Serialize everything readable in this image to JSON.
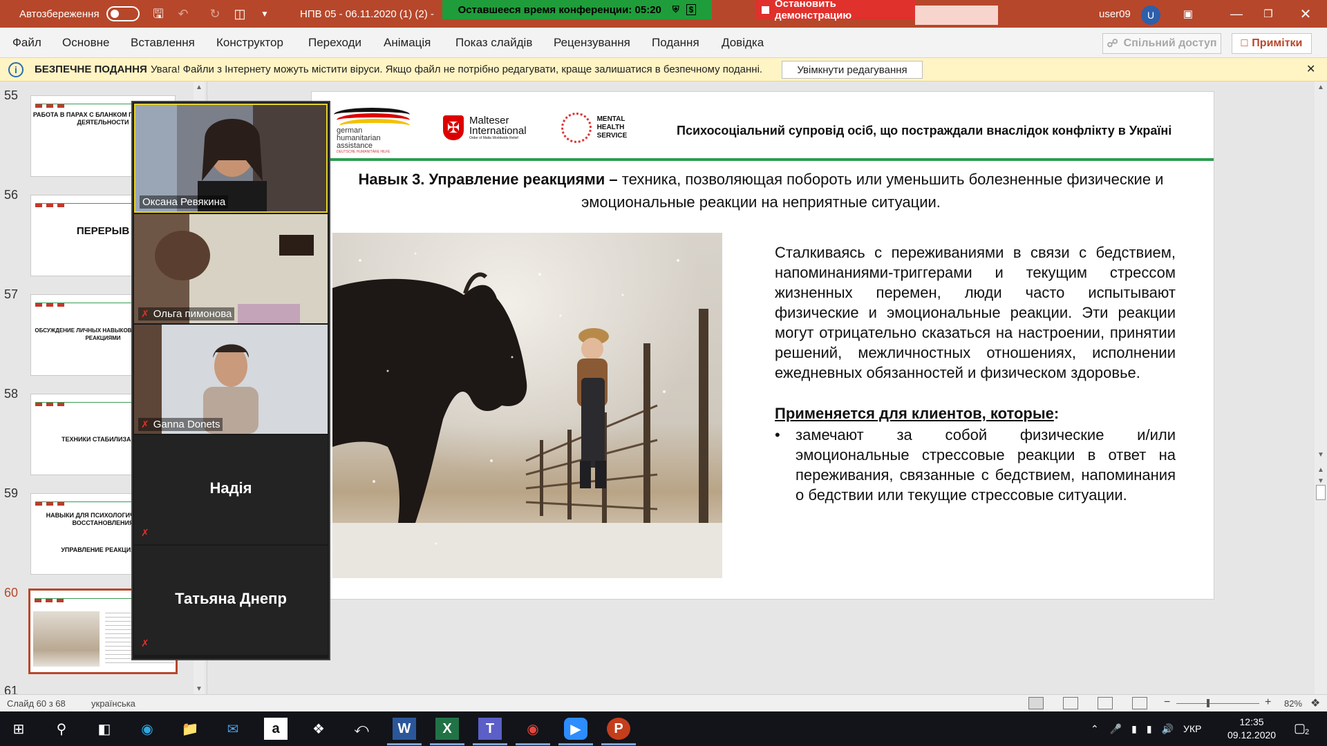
{
  "titlebar": {
    "autosave_label": "Автозбереження",
    "doc_title": "НПВ 05 - 06.11.2020 (1) (2) -",
    "user": "user09",
    "user_initial": "U",
    "colors": {
      "brand": "#b7472a"
    }
  },
  "zoom": {
    "time_left": "Оставшееся время конференции: 05:20",
    "stop_demo": "Остановить демонстрацию"
  },
  "ribbon": {
    "tabs": [
      "Файл",
      "Основне",
      "Вставлення",
      "Конструктор",
      "Переходи",
      "Анімація",
      "Показ слайдів",
      "Рецензування",
      "Подання",
      "Довідка"
    ],
    "share": "Спільний доступ",
    "notes": "Примітки"
  },
  "protected_view": {
    "label": "БЕЗПЕЧНЕ ПОДАННЯ",
    "message": "Увага! Файли з Інтернету можуть містити віруси. Якщо файл не потрібно редагувати, краще залишатися в безпечному поданні.",
    "enable_editing": "Увімкнути редагування"
  },
  "thumbnails": [
    {
      "num": "55",
      "title": "РАБОТА В ПАРАХ С БЛАНКОМ ПОЗИТИВНОЙ ДЕЯТЕЛЬНОСТИ"
    },
    {
      "num": "56",
      "title": "ПЕРЕРЫВ"
    },
    {
      "num": "57",
      "title": "ОБСУЖДЕНИЕ ЛИЧНЫХ НАВЫКОВ УПРАВЛЕНИЯ РЕАКЦИЯМИ"
    },
    {
      "num": "58",
      "title": "ТЕХНИКИ СТАБИЛИЗАЦИИ"
    },
    {
      "num": "59",
      "title": "НАВЫКИ ДЛЯ ПСИХОЛОГИЧЕСКОГО ВОССТАНОВЛЕНИЯ",
      "subtitle": "УПРАВЛЕНИЕ РЕАКЦИЯМИ"
    },
    {
      "num": "60",
      "title": ""
    },
    {
      "num": "61",
      "title": ""
    }
  ],
  "participants": [
    {
      "name": "Оксана Ревякина",
      "video": true,
      "muted": false
    },
    {
      "name": "Ольга пимонова",
      "video": true,
      "muted": true
    },
    {
      "name": "Ganna Donets",
      "video": true,
      "muted": true
    },
    {
      "name": "Надія",
      "video": false,
      "muted": true
    },
    {
      "name": "Татьяна Днепр",
      "video": false,
      "muted": true
    }
  ],
  "slide": {
    "logo_german": [
      "german",
      "humanitarian",
      "assistance"
    ],
    "logo_german_sub": "DEUTSCHE HUMANITÄRE HILFE",
    "logo_malteser": [
      "Malteser",
      "International"
    ],
    "logo_malteser_sub": "Order of Malta Worldwide Relief",
    "logo_mh": [
      "MENTAL",
      "HEALTH",
      "SERVICE"
    ],
    "header_title": "Психосоціальний супровід осіб, що постраждали внаслідок конфлікту в Україні",
    "skill_bold": "Навык 3. Управление реакциями –",
    "skill_rest": " техника, позволяющая побороть или уменьшить болезненные физические и эмоциональные реакции на неприятные ситуации.",
    "paragraph": "Сталкиваясь с переживаниями в связи с бедствием, напоминаниями-триггерами и текущим стрессом жизненных перемен, люди часто испытывают физические и эмоциональные реакции. Эти реакции могут отрицательно сказаться на настроении, принятии решений, межличностных отношениях, исполнении ежедневных обязанностей и физическом здоровье.",
    "applies_label": "Применяется для клиентов, которые",
    "applies_colon": ":",
    "bullet": "замечают за собой физические и/или эмоциональные стрессовые реакции в ответ на переживания, связанные с бедствием, напоминания о бедствии или текущие стрессовые ситуации."
  },
  "statusbar": {
    "slide_info": "Слайд 60 з 68",
    "language": "українська",
    "zoom": "82%"
  },
  "taskbar": {
    "time": "12:35",
    "date": "09.12.2020",
    "lang": "УКР",
    "notif_count": "2"
  }
}
